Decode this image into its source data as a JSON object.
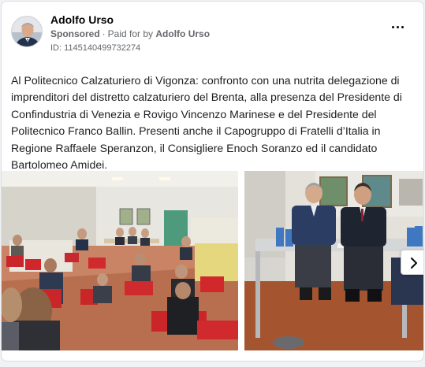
{
  "post": {
    "author": "Adolfo Urso",
    "sponsored_label": "Sponsored",
    "paid_prefix": "Paid for by",
    "paid_by": "Adolfo Urso",
    "ad_id": "ID: 1145140499732274",
    "text": "Al Politecnico Calzaturiero di Vigonza: confronto con una nutrita delegazione di imprenditori del distretto calzaturiero del Brenta, alla presenza del Presidente di Confindustria di Venezia e Rovigo Vincenzo Marinese e del Presidente del Politecnico Franco Ballin. Presenti anche il Capogruppo di Fratelli d’Italia in Regione Raffaele Speranzon, il Consigliere Enoch Soranzo ed il candidato Bartolomeo Amidei."
  },
  "icons": {
    "more": "more-options-icon",
    "next": "chevron-right-icon"
  },
  "colors": {
    "card_bg": "#ffffff",
    "page_bg": "#f0f2f5",
    "secondary_text": "#65676b"
  }
}
